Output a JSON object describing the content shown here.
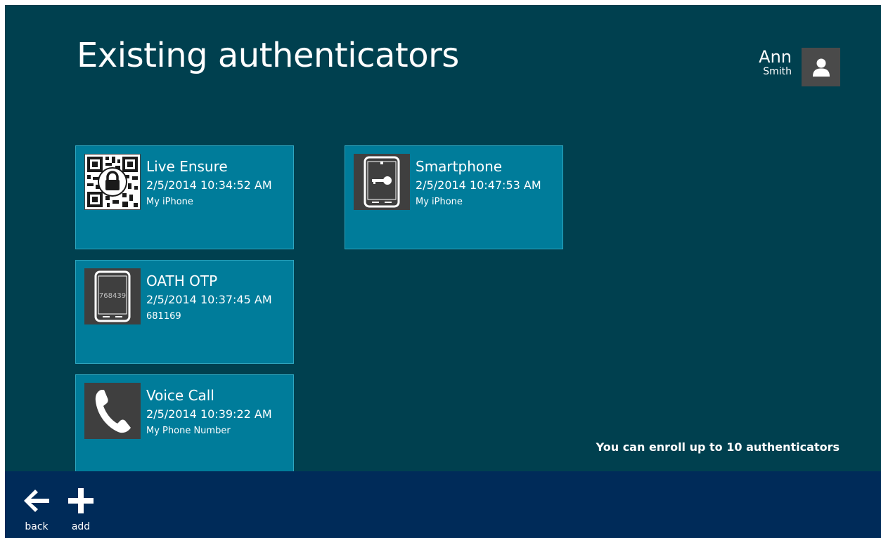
{
  "header": {
    "title": "Existing authenticators"
  },
  "user": {
    "first_name": "Ann",
    "last_name": "Smith",
    "avatar_icon": "user-icon"
  },
  "authenticators": [
    {
      "name": "Live Ensure",
      "date": "2/5/2014 10:34:52 AM",
      "detail": "My iPhone",
      "icon": "qr-lock-icon"
    },
    {
      "name": "OATH OTP",
      "date": "2/5/2014 10:37:45 AM",
      "detail": "681169",
      "icon": "phone-otp-icon",
      "icon_text": "768439"
    },
    {
      "name": "Voice Call",
      "date": "2/5/2014 10:39:22 AM",
      "detail": "My Phone Number",
      "icon": "phone-handset-icon"
    },
    {
      "name": "Smartphone",
      "date": "2/5/2014 10:47:53 AM",
      "detail": "My iPhone",
      "icon": "phone-key-icon"
    }
  ],
  "enroll_note": "You can enroll up to 10 authenticators",
  "appbar": {
    "back_label": "back",
    "add_label": "add"
  },
  "colors": {
    "background": "#00404f",
    "tile": "#007c9a",
    "tile_border": "#2ea7c0",
    "icon_bg": "#3f3f3f",
    "appbar": "#002b59",
    "text": "#ffffff"
  }
}
